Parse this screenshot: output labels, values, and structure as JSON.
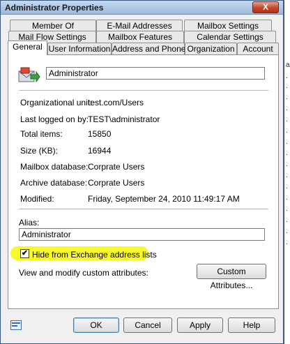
{
  "window": {
    "title": "Administrator Properties",
    "close_label": "X"
  },
  "tabs": {
    "row1": [
      {
        "label": "Member Of"
      },
      {
        "label": "E-Mail Addresses"
      },
      {
        "label": "Mailbox Settings"
      }
    ],
    "row2": [
      {
        "label": "Mail Flow Settings"
      },
      {
        "label": "Mailbox Features"
      },
      {
        "label": "Calendar Settings"
      }
    ],
    "row3": [
      {
        "label": "General",
        "active": true
      },
      {
        "label": "User Information"
      },
      {
        "label": "Address and Phone"
      },
      {
        "label": "Organization"
      },
      {
        "label": "Account"
      }
    ]
  },
  "general": {
    "display_name": "Administrator",
    "fields": [
      {
        "label": "Organizational unit:",
        "value": "test.com/Users"
      },
      {
        "label": "Last logged on by:",
        "value": "TEST\\administrator"
      },
      {
        "label": "Total items:",
        "value": "15850"
      },
      {
        "label": "Size (KB):",
        "value": "16944"
      },
      {
        "label": "Mailbox database:",
        "value": "Corprate Users"
      },
      {
        "label": "Archive database:",
        "value": "Corprate Users"
      },
      {
        "label": "Modified:",
        "value": "Friday, September 24, 2010 11:49:17 AM"
      }
    ],
    "alias_label": "Alias:",
    "alias_value": "Administrator",
    "hide_checkbox_label": "Hide from Exchange address lists",
    "hide_checked": true,
    "custom_attributes_label": "View and modify custom attributes:",
    "custom_attributes_button": "Custom Attributes..."
  },
  "footer": {
    "ok": "OK",
    "cancel": "Cancel",
    "apply": "Apply",
    "help": "Help"
  },
  "background_marks": [
    "a",
    ".",
    ".",
    ".",
    ".",
    ".",
    ".",
    ".",
    ".",
    ".",
    ".",
    ".",
    ".",
    ".",
    ".",
    ".",
    "."
  ],
  "colors": {
    "highlight": "#f8f82a",
    "titlebar": "#9fb9db"
  }
}
